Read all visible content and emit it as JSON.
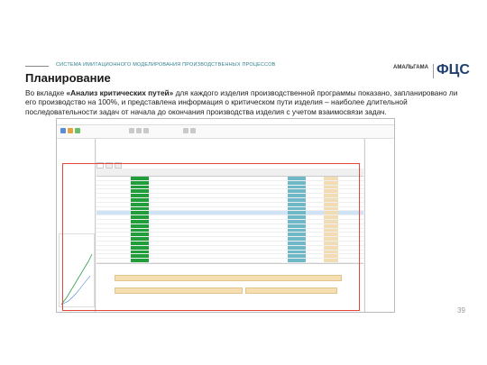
{
  "header": {
    "subtitle": "СИСТЕМА ИМИТАЦИОННОГО МОДЕЛИРОВАНИЯ ПРОИЗВОДСТВЕННЫХ ПРОЦЕССОВ",
    "title": "Планирование",
    "logo_left": "АМАЛЬГАМА",
    "logo_right": "ФЦС"
  },
  "body": {
    "para_1": "Во вкладке ",
    "para_bold": "«Анализ критических путей»",
    "para_2": " для каждого изделия производственной программы показано, запланировано ли его производство на 100%, и представлена информация о критическом пути изделия – наиболее длительной последовательности задач от начала до окончания производства изделия с учетом взаимосвязи задач."
  },
  "page_number": "39",
  "colors": {
    "accent": "#2f7f8f",
    "highlight_frame": "#e8443a",
    "progress_green": "#1f9e3a",
    "bar_teal": "#6fb8c7",
    "gantt_tan": "#f2dcb3"
  }
}
